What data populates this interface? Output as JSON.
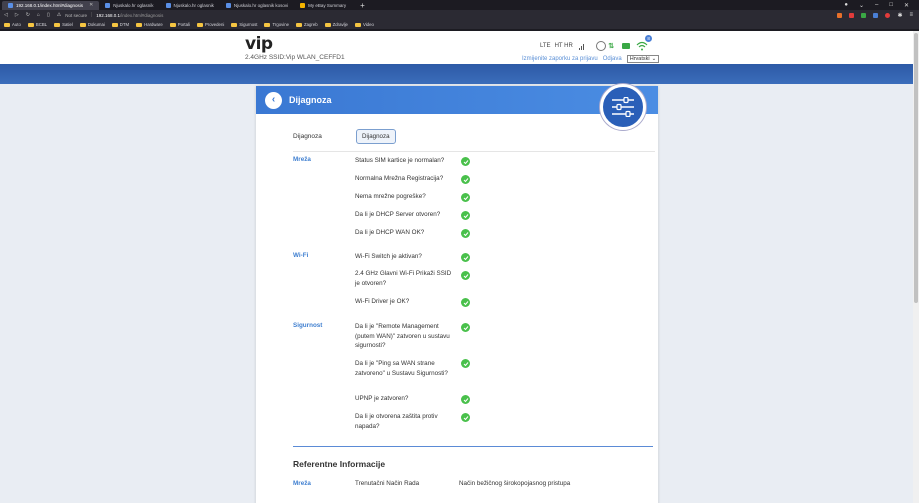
{
  "browser": {
    "tabs": [
      {
        "label": "192.168.0.1/index.html#diagnosis",
        "active": true
      },
      {
        "label": "Njuskalo.hr oglasnik",
        "active": false
      },
      {
        "label": "Njuskalo.hr oglasnik",
        "active": false
      },
      {
        "label": "Njuskalo.hr oglasnik kosovi",
        "active": false
      },
      {
        "label": "My eBay Summary",
        "active": false
      }
    ],
    "url_not_secure": "Not secure",
    "url_host": "192.168.0.1",
    "url_rest": "/index.html#diagnosis",
    "bookmarks": [
      "Auto",
      "BCBL",
      "Satiel",
      "Dokumai",
      "DTM",
      "Hardware",
      "Portali",
      "Provedeni",
      "Sigurnost",
      "Trgovine",
      "Zagreb",
      "Zdravlje",
      "Video"
    ]
  },
  "header": {
    "logo": "vip",
    "ssid": "2.4GHz SSID:Vip WLAN_CEFFD1",
    "network_type": "LTE",
    "operator": "HT HR",
    "wifi_badge": "8",
    "change_password_link": "Izmijenite zaporku za prijavu",
    "logout_link": "Odjava",
    "language": "Hrvatski"
  },
  "panel": {
    "title": "Dijagnoza",
    "diag_label": "Dijagnoza",
    "diag_button": "Dijagnoza",
    "sections": [
      {
        "name": "Mreža",
        "items": [
          {
            "text": "Status SIM kartice je normalan?",
            "ok": true
          },
          {
            "text": "Normalna Mrežna Registracija?",
            "ok": true
          },
          {
            "text": "Nema mrežne pogreške?",
            "ok": true
          },
          {
            "text": "Da li je DHCP Server otvoren?",
            "ok": true
          },
          {
            "text": "Da li je DHCP WAN OK?",
            "ok": true
          }
        ]
      },
      {
        "name": "Wi-Fi",
        "items": [
          {
            "text": "Wi-Fi Switch je aktivan?",
            "ok": true
          },
          {
            "text": "2.4 GHz Glavni Wi-Fi Prikaži SSID je otvoren?",
            "ok": true
          },
          {
            "text": "Wi-Fi Driver je OK?",
            "ok": true
          }
        ]
      },
      {
        "name": "Sigurnost",
        "items": [
          {
            "text": "Da li je \"Remote Management (putem WAN)\" zatvoren u sustavu sigurnosti?",
            "ok": true
          },
          {
            "text": "Da li je \"Ping sa WAN strane zatvoreno\" u Sustavu Sigurnosti?",
            "ok": true
          },
          {
            "text": "UPNP je zatvoren?",
            "ok": true
          },
          {
            "text": "Da li je otvorena zaštita protiv napada?",
            "ok": true
          }
        ]
      }
    ],
    "ref_title": "Referentne Informacije",
    "ref_section": "Mreža",
    "ref_key": "Trenutačni Način Rada",
    "ref_value": "Način bežičnog širokopojasnog pristupa"
  },
  "colors": {
    "accent": "#3a78d3",
    "check": "#49c04b",
    "section_label": "#3f7fd0"
  }
}
